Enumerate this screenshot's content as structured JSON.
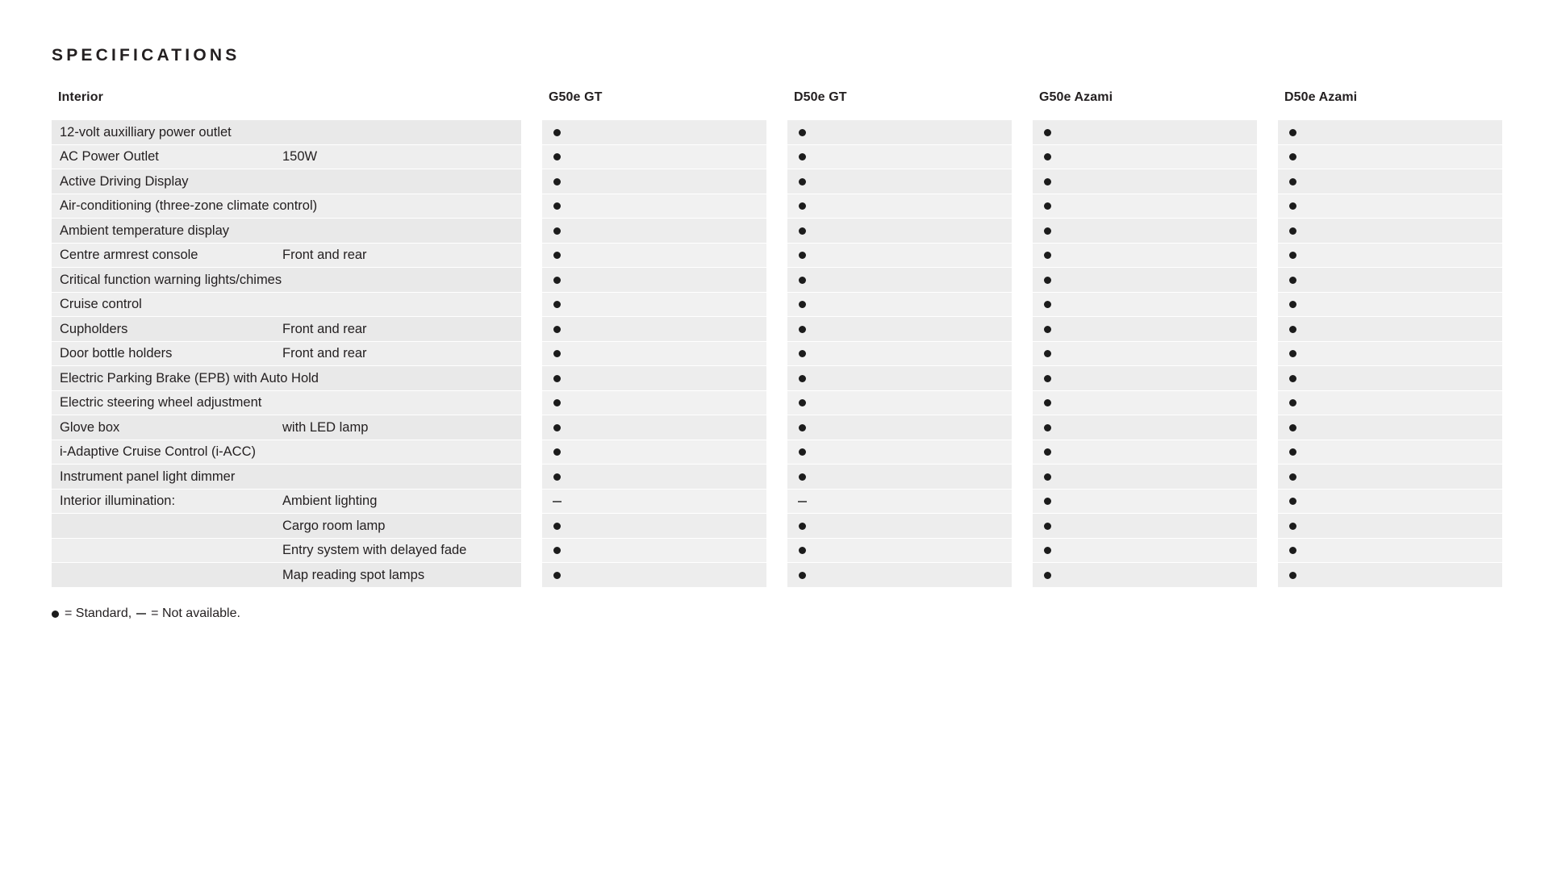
{
  "page": {
    "title": "SPECIFICATIONS",
    "background": "#ffffff",
    "text_color": "#231f20",
    "band_color": "#e9e9e9",
    "dot_color": "#1c1c1c"
  },
  "table": {
    "category_header": "Interior",
    "columns": [
      "G50e GT",
      "D50e GT",
      "G50e Azami",
      "D50e Azami"
    ],
    "rows": [
      {
        "label": "12-volt auxilliary power outlet",
        "sub": "",
        "values": [
          "dot",
          "dot",
          "dot",
          "dot"
        ]
      },
      {
        "label": "AC Power Outlet",
        "sub": "150W",
        "values": [
          "dot",
          "dot",
          "dot",
          "dot"
        ]
      },
      {
        "label": "Active Driving Display",
        "sub": "",
        "values": [
          "dot",
          "dot",
          "dot",
          "dot"
        ]
      },
      {
        "label": "Air-conditioning (three-zone climate control)",
        "sub": "",
        "values": [
          "dot",
          "dot",
          "dot",
          "dot"
        ]
      },
      {
        "label": "Ambient temperature display",
        "sub": "",
        "values": [
          "dot",
          "dot",
          "dot",
          "dot"
        ]
      },
      {
        "label": "Centre armrest console",
        "sub": "Front and rear",
        "values": [
          "dot",
          "dot",
          "dot",
          "dot"
        ]
      },
      {
        "label": "Critical function warning lights/chimes",
        "sub": "",
        "values": [
          "dot",
          "dot",
          "dot",
          "dot"
        ]
      },
      {
        "label": "Cruise control",
        "sub": "",
        "values": [
          "dot",
          "dot",
          "dot",
          "dot"
        ]
      },
      {
        "label": "Cupholders",
        "sub": "Front and rear",
        "values": [
          "dot",
          "dot",
          "dot",
          "dot"
        ]
      },
      {
        "label": "Door bottle holders",
        "sub": "Front and rear",
        "values": [
          "dot",
          "dot",
          "dot",
          "dot"
        ]
      },
      {
        "label": "Electric Parking Brake (EPB) with Auto Hold",
        "sub": "",
        "values": [
          "dot",
          "dot",
          "dot",
          "dot"
        ]
      },
      {
        "label": "Electric steering wheel adjustment",
        "sub": "",
        "values": [
          "dot",
          "dot",
          "dot",
          "dot"
        ]
      },
      {
        "label": "Glove box",
        "sub": "with LED lamp",
        "values": [
          "dot",
          "dot",
          "dot",
          "dot"
        ]
      },
      {
        "label": "i-Adaptive Cruise Control (i-ACC)",
        "sub": "",
        "values": [
          "dot",
          "dot",
          "dot",
          "dot"
        ]
      },
      {
        "label": "Instrument panel light dimmer",
        "sub": "",
        "values": [
          "dot",
          "dot",
          "dot",
          "dot"
        ]
      },
      {
        "label": "Interior illumination:",
        "sub": "Ambient lighting",
        "values": [
          "dash",
          "dash",
          "dot",
          "dot"
        ]
      },
      {
        "label": "",
        "sub": "Cargo room lamp",
        "values": [
          "dot",
          "dot",
          "dot",
          "dot"
        ]
      },
      {
        "label": "",
        "sub": "Entry system with delayed fade",
        "values": [
          "dot",
          "dot",
          "dot",
          "dot"
        ]
      },
      {
        "label": "",
        "sub": "Map reading spot lamps",
        "values": [
          "dot",
          "dot",
          "dot",
          "dot"
        ]
      }
    ]
  },
  "legend": {
    "standard_text": "= Standard,",
    "not_available_text": "= Not available."
  }
}
